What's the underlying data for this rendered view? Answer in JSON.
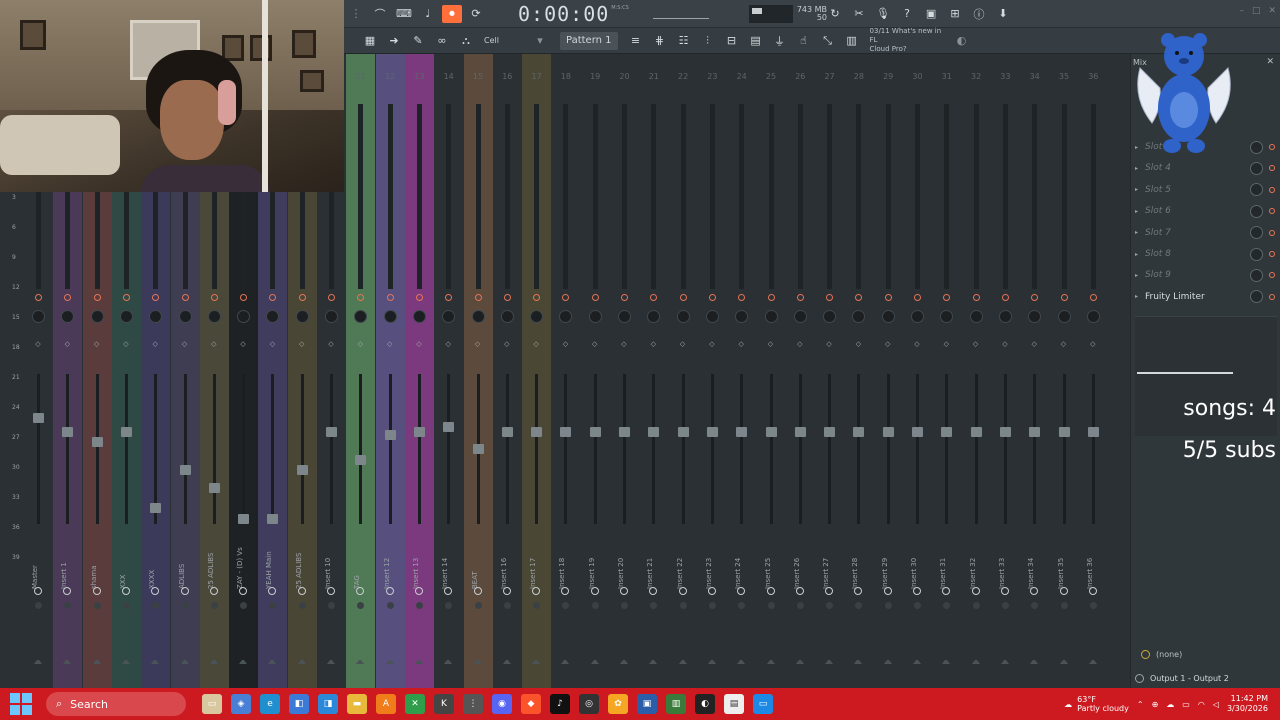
{
  "toolbar": {
    "time": "0:00:00",
    "time_unit": "M:S:CS",
    "cpu_value": "24",
    "memory": "743 MB",
    "voices": "50",
    "select_mode": "Cell",
    "pattern": "Pattern 1",
    "news_line1": "03/11  What's new in FL",
    "news_line2": "Cloud Pro?"
  },
  "scale": [
    "3",
    "6",
    "9",
    "12",
    "15",
    "18",
    "21",
    "24",
    "27",
    "30",
    "33",
    "36",
    "39"
  ],
  "tracks": [
    {
      "num": "",
      "label": "Master",
      "color": "#2a3034",
      "fader": 0.72
    },
    {
      "num": "",
      "label": "Insert 1",
      "color": "#4a3a58",
      "fader": 0.62
    },
    {
      "num": "",
      "label": "shama",
      "color": "#5a3c3c",
      "fader": 0.55
    },
    {
      "num": "",
      "label": "XXX",
      "color": "#2f4a44",
      "fader": 0.62
    },
    {
      "num": "",
      "label": "XXXX",
      "color": "#3c3a5a",
      "fader": 0.08
    },
    {
      "num": "",
      "label": "ADLIBS",
      "color": "#3f3d52",
      "fader": 0.35
    },
    {
      "num": "",
      "label": "25 ADLIBS",
      "color": "#4a4838",
      "fader": 0.22
    },
    {
      "num": "",
      "label": "ZAY - (D) Vs",
      "color": "#1e2224",
      "fader": 0.0
    },
    {
      "num": "",
      "label": "YEAH Main",
      "color": "#3f3c5e",
      "fader": 0.0
    },
    {
      "num": "",
      "label": "25 ADLIBS",
      "color": "#4a4636",
      "fader": 0.35
    },
    {
      "num": "",
      "label": "Insert 10",
      "color": "#2a3034",
      "fader": 0.62
    },
    {
      "num": "11",
      "label": "TAG",
      "color": "#4f7a55",
      "fader": 0.42
    },
    {
      "num": "12",
      "label": "Insert 12",
      "color": "#57507e",
      "fader": 0.6
    },
    {
      "num": "13",
      "label": "Insert 13",
      "color": "#7c3a7e",
      "fader": 0.62
    },
    {
      "num": "14",
      "label": "Insert 14",
      "color": "#2a3034",
      "fader": 0.66
    },
    {
      "num": "15",
      "label": "BEAT",
      "color": "#5c4a3c",
      "fader": 0.5
    },
    {
      "num": "16",
      "label": "Insert 16",
      "color": "#2a3034",
      "fader": 0.62
    },
    {
      "num": "17",
      "label": "Insert 17",
      "color": "#4a4834",
      "fader": 0.62
    },
    {
      "num": "18",
      "label": "Insert 18",
      "color": "#2a3034",
      "fader": 0.62
    },
    {
      "num": "19",
      "label": "Insert 19",
      "color": "#2a3034",
      "fader": 0.62
    },
    {
      "num": "20",
      "label": "Insert 20",
      "color": "#2a3034",
      "fader": 0.62
    },
    {
      "num": "21",
      "label": "Insert 21",
      "color": "#2a3034",
      "fader": 0.62
    },
    {
      "num": "22",
      "label": "Insert 22",
      "color": "#2a3034",
      "fader": 0.62
    },
    {
      "num": "23",
      "label": "Insert 23",
      "color": "#2a3034",
      "fader": 0.62
    },
    {
      "num": "24",
      "label": "Insert 24",
      "color": "#2a3034",
      "fader": 0.62
    },
    {
      "num": "25",
      "label": "Insert 25",
      "color": "#2a3034",
      "fader": 0.62
    },
    {
      "num": "26",
      "label": "Insert 26",
      "color": "#2a3034",
      "fader": 0.62
    },
    {
      "num": "27",
      "label": "Insert 27",
      "color": "#2a3034",
      "fader": 0.62
    },
    {
      "num": "28",
      "label": "Insert 28",
      "color": "#2a3034",
      "fader": 0.62
    },
    {
      "num": "29",
      "label": "Insert 29",
      "color": "#2a3034",
      "fader": 0.62
    },
    {
      "num": "30",
      "label": "Insert 30",
      "color": "#2a3034",
      "fader": 0.62
    },
    {
      "num": "31",
      "label": "Insert 31",
      "color": "#2a3034",
      "fader": 0.62
    },
    {
      "num": "32",
      "label": "Insert 32",
      "color": "#2a3034",
      "fader": 0.62
    },
    {
      "num": "33",
      "label": "Insert 33",
      "color": "#2a3034",
      "fader": 0.62
    },
    {
      "num": "34",
      "label": "Insert 34",
      "color": "#2a3034",
      "fader": 0.62
    },
    {
      "num": "35",
      "label": "Insert 35",
      "color": "#2a3034",
      "fader": 0.62
    },
    {
      "num": "36",
      "label": "Insert 36",
      "color": "#2a3034",
      "fader": 0.62
    }
  ],
  "panel": {
    "title": "Mix",
    "slots": [
      "Slot 3",
      "Slot 4",
      "Slot 5",
      "Slot 6",
      "Slot 7",
      "Slot 8",
      "Slot 9"
    ],
    "active_slot": "Fruity Limiter",
    "none_label": "(none)",
    "output": "Output 1 - Output 2"
  },
  "overlay": {
    "songs": "songs: 4",
    "subs": "5/5 subs"
  },
  "taskbar": {
    "search": "Search",
    "weather_temp": "63°F",
    "weather_desc": "Partly cloudy",
    "time": "11:42 PM",
    "date": "3/30/2026"
  }
}
